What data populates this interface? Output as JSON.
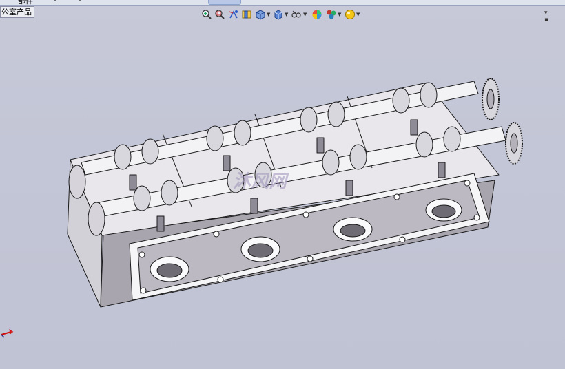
{
  "menu_strip": {
    "part_label": "部件",
    "dropdown_caret": "▾"
  },
  "context_label": "公室产品",
  "heads_up_toolbar": [
    {
      "name": "zoom-to-fit-icon",
      "dropdown": false
    },
    {
      "name": "zoom-to-area-icon",
      "dropdown": false
    },
    {
      "name": "previous-view-icon",
      "dropdown": false
    },
    {
      "name": "section-view-icon",
      "dropdown": false
    },
    {
      "name": "view-orientation-icon",
      "dropdown": true
    },
    {
      "name": "display-style-icon",
      "dropdown": true
    },
    {
      "name": "hide-show-items-icon",
      "dropdown": true
    },
    {
      "name": "edit-appearance-icon",
      "dropdown": false
    },
    {
      "name": "apply-scene-icon",
      "dropdown": true
    },
    {
      "name": "view-settings-icon",
      "dropdown": true
    }
  ],
  "window_controls": "▾ ▪",
  "watermark": "沐风网",
  "colors": {
    "viewport_bg": "#c3c6d6",
    "model_fill": "#f2f0f4",
    "model_edge": "#1a1a1a",
    "face_shade": "#a7a3ad",
    "triad_red": "#d01010"
  }
}
